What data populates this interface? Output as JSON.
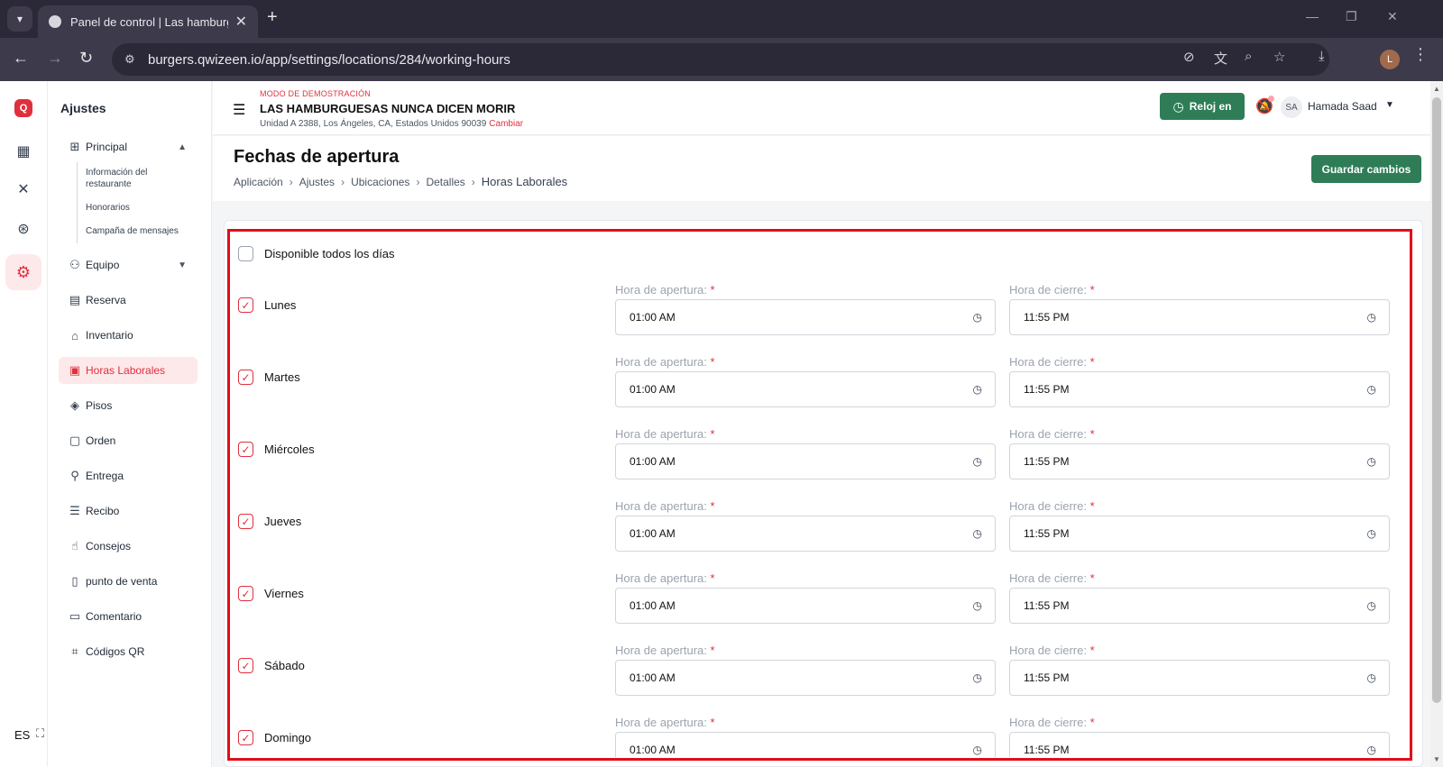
{
  "browser": {
    "tab_title": "Panel de control | Las hamburguesas",
    "url": "burgers.qwizeen.io/app/settings/locations/284/working-hours",
    "profile_initial": "L"
  },
  "rail": {
    "logo": "Q",
    "language": "ES"
  },
  "sidebar": {
    "title": "Ajustes",
    "principal": "Principal",
    "sub_items": [
      "Información del restaurante",
      "Honorarios",
      "Campaña de mensajes"
    ],
    "items": [
      "Equipo",
      "Reserva",
      "Inventario",
      "Horas Laborales",
      "Pisos",
      "Orden",
      "Entrega",
      "Recibo",
      "Consejos",
      "punto de venta",
      "Comentario",
      "Códigos QR"
    ]
  },
  "header": {
    "demo_mode": "MODO DE DEMOSTRACIÓN",
    "restaurant_name": "LAS HAMBURGUESAS NUNCA DICEN MORIR",
    "address": "Unidad A 2388, Los Ángeles, CA, Estados Unidos 90039",
    "change": "Cambiar",
    "clock_button": "Reloj en",
    "avatar": "SA",
    "user_name": "Hamada Saad"
  },
  "page": {
    "title": "Fechas de apertura",
    "breadcrumb": [
      "Aplicación",
      "Ajustes",
      "Ubicaciones",
      "Detalles",
      "Horas Laborales"
    ],
    "save_button": "Guardar cambios"
  },
  "form": {
    "all_days_label": "Disponible todos los días",
    "open_label": "Hora de apertura:",
    "close_label": "Hora de cierre:",
    "required_mark": "*",
    "days": [
      {
        "name": "Lunes",
        "open": "01:00 AM",
        "close": "11:55 PM"
      },
      {
        "name": "Martes",
        "open": "01:00 AM",
        "close": "11:55 PM"
      },
      {
        "name": "Miércoles",
        "open": "01:00 AM",
        "close": "11:55 PM"
      },
      {
        "name": "Jueves",
        "open": "01:00 AM",
        "close": "11:55 PM"
      },
      {
        "name": "Viernes",
        "open": "01:00 AM",
        "close": "11:55 PM"
      },
      {
        "name": "Sábado",
        "open": "01:00 AM",
        "close": "11:55 PM"
      },
      {
        "name": "Domingo",
        "open": "01:00 AM",
        "close": "11:55 PM"
      }
    ]
  },
  "colors": {
    "accent": "#e0303e",
    "primary_button": "#2e7d57",
    "highlight_border": "#e00d1a"
  }
}
